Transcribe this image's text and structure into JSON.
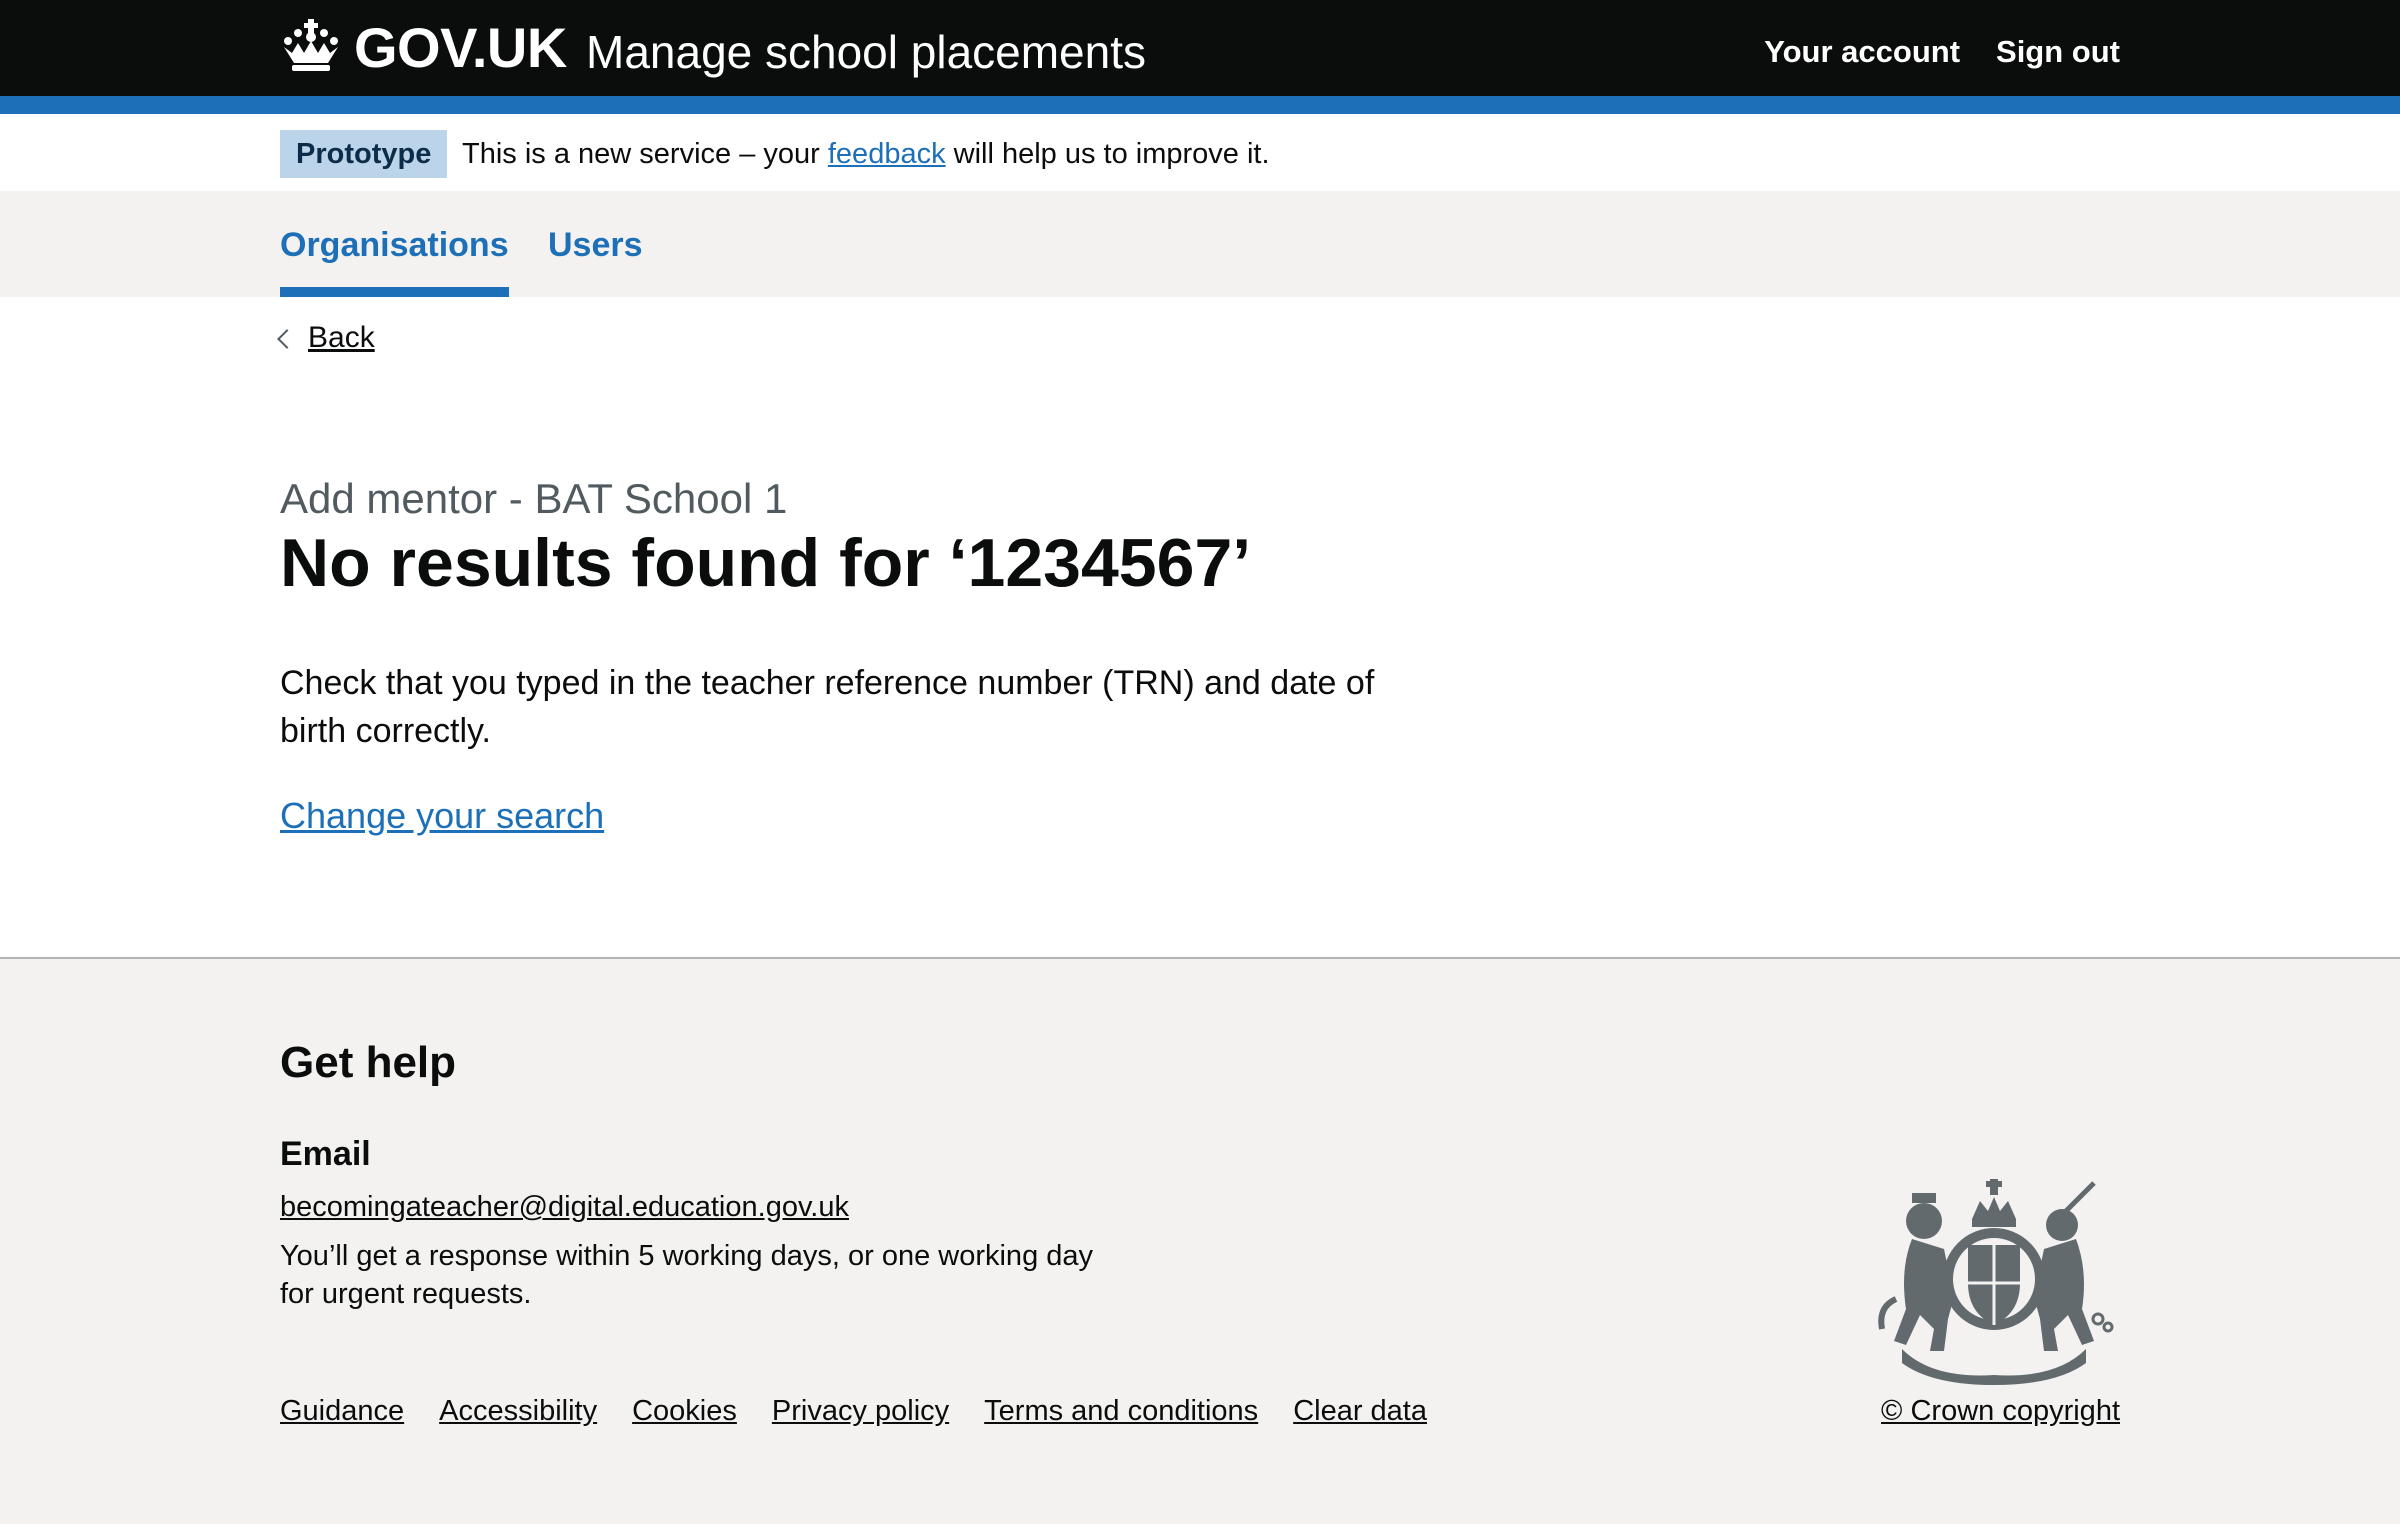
{
  "header": {
    "logo_text": "GOV.UK",
    "service_name": "Manage school placements",
    "nav": [
      {
        "label": "Your account"
      },
      {
        "label": "Sign out"
      }
    ]
  },
  "phase_banner": {
    "tag": "Prototype",
    "text_before": "This is a new service – your",
    "link": "feedback",
    "text_after": "will help us to improve it."
  },
  "primary_nav": {
    "items": [
      {
        "label": "Organisations",
        "active": true
      },
      {
        "label": "Users",
        "active": false
      }
    ]
  },
  "main": {
    "back_label": "Back",
    "caption": "Add mentor - BAT School 1",
    "title": "No results found for ‘1234567’",
    "body": "Check that you typed in the teacher reference number (TRN) and date of birth correctly.",
    "change_link": "Change your search"
  },
  "footer": {
    "help_title": "Get help",
    "email_title": "Email",
    "email": "becomingateacher@digital.education.gov.uk",
    "response_text": "You’ll get a response within 5 working days, or one working day for urgent requests.",
    "links": [
      {
        "label": "Guidance"
      },
      {
        "label": "Accessibility"
      },
      {
        "label": "Cookies"
      },
      {
        "label": "Privacy policy"
      },
      {
        "label": "Terms and conditions"
      },
      {
        "label": "Clear data"
      }
    ],
    "copyright": "© Crown copyright",
    "crest_icon": "royal-coat-of-arms-icon"
  },
  "colors": {
    "header_bg": "#0b0c0c",
    "brand_blue": "#1d70b8",
    "tag_bg": "#bbd4ea",
    "footer_bg": "#f3f2f1",
    "secondary_text": "#505a5f"
  }
}
